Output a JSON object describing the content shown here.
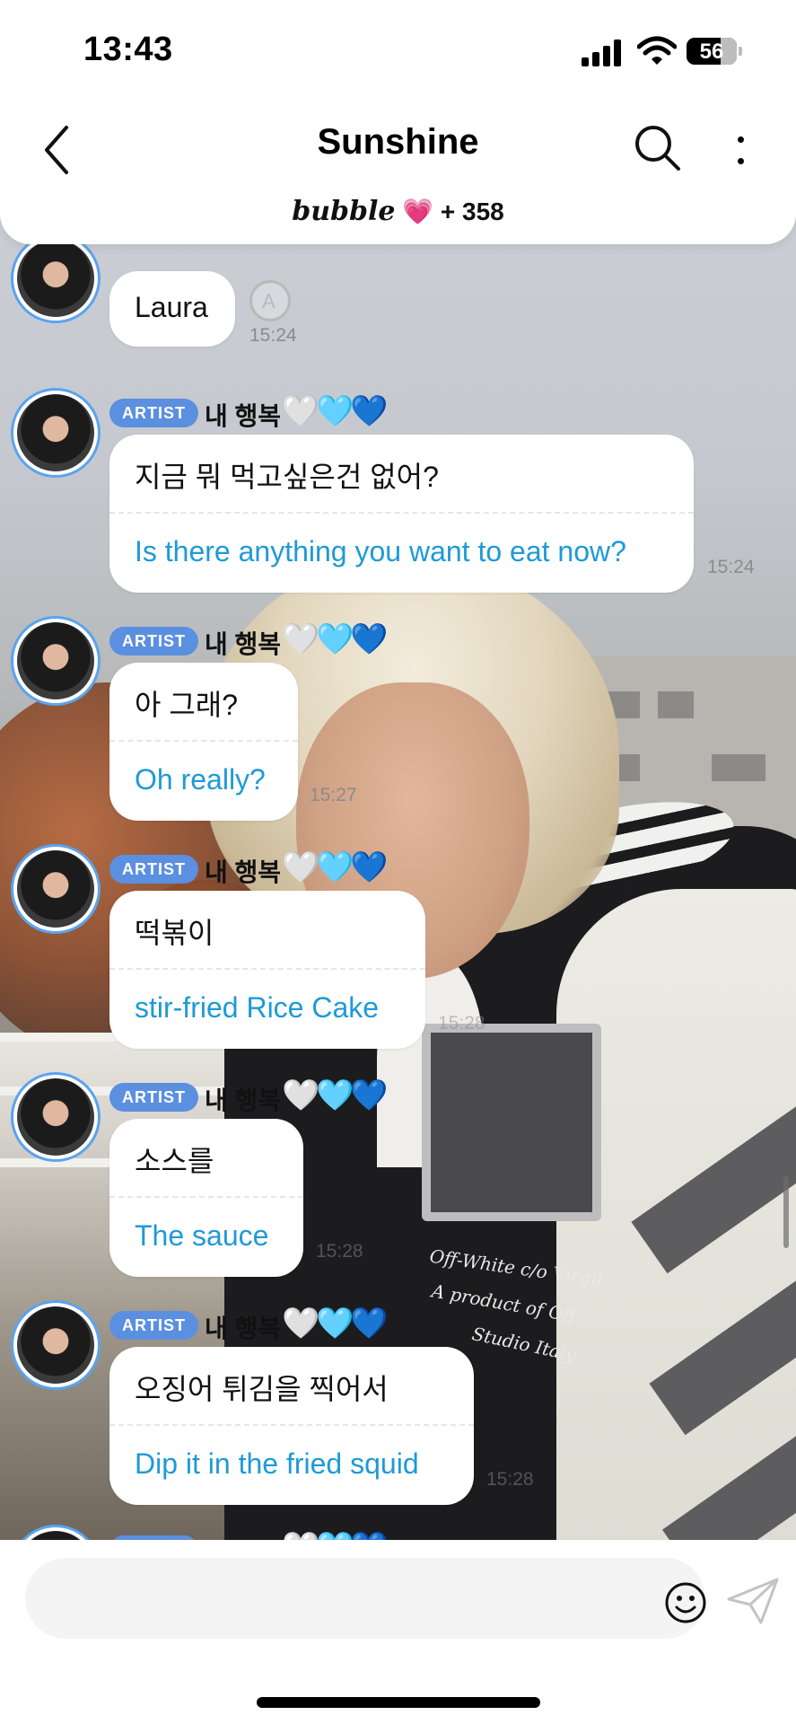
{
  "status_bar": {
    "time": "13:43",
    "battery": "56"
  },
  "header": {
    "title": "Sunshine",
    "bubble_word": "bubble",
    "heart": "💗",
    "member_count": "+ 358"
  },
  "artist_badge": "ARTIST",
  "artist_name": "내 행복",
  "hearts": [
    "🤍",
    "🩵",
    "💙"
  ],
  "messages": [
    {
      "ko": "Laura",
      "time": "15:24"
    },
    {
      "ko": "지금 뭐 먹고싶은건 없어?",
      "en": "Is there anything you want to eat now?",
      "time": "15:24"
    },
    {
      "ko": "아 그래?",
      "en": "Oh really?",
      "time": "15:27"
    },
    {
      "ko": "떡볶이",
      "en": "stir-fried Rice Cake",
      "time": "15:28"
    },
    {
      "ko": "소스를",
      "en": "The sauce",
      "time": "15:28"
    },
    {
      "ko": "오징어 튀김을 찍어서",
      "en": "Dip it in the fried squid",
      "time": "15:28"
    }
  ],
  "background_jacket_text": [
    "Off-White c/o Virgil",
    "A product of Off-",
    "Studio Italy"
  ],
  "icons": {
    "back": "chevron-left-icon",
    "search": "search-icon",
    "more": "more-vertical-icon",
    "translate": "translate-icon",
    "emoji": "emoji-icon",
    "send": "send-icon"
  },
  "colors": {
    "artist_badge": "#5b8fe0",
    "translation_text": "#1e9ad6",
    "avatar_ring": "#5aa3f0"
  }
}
